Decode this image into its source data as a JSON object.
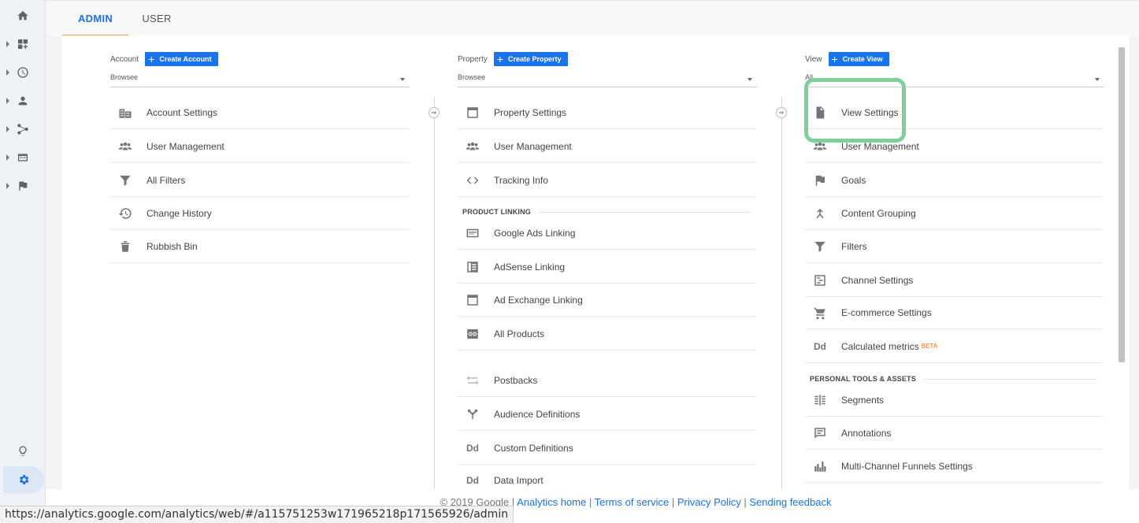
{
  "tabs": {
    "admin": "ADMIN",
    "user": "USER"
  },
  "account": {
    "label": "Account",
    "create": "Create Account",
    "selected": "Browsee",
    "items": [
      {
        "label": "Account Settings",
        "icon": "building-icon"
      },
      {
        "label": "User Management",
        "icon": "people-icon"
      },
      {
        "label": "All Filters",
        "icon": "filter-icon"
      },
      {
        "label": "Change History",
        "icon": "history-icon"
      },
      {
        "label": "Rubbish Bin",
        "icon": "trash-icon"
      }
    ]
  },
  "property": {
    "label": "Property",
    "create": "Create Property",
    "selected": "Browsee",
    "items": [
      {
        "label": "Property Settings",
        "icon": "square-icon"
      },
      {
        "label": "User Management",
        "icon": "people-icon"
      },
      {
        "label": "Tracking Info",
        "icon": "code-icon"
      }
    ],
    "linking_header": "PRODUCT LINKING",
    "linking": [
      {
        "label": "Google Ads Linking",
        "icon": "ads-icon"
      },
      {
        "label": "AdSense Linking",
        "icon": "adsense-icon"
      },
      {
        "label": "Ad Exchange Linking",
        "icon": "square-icon"
      },
      {
        "label": "All Products",
        "icon": "link-icon"
      }
    ],
    "more": [
      {
        "label": "Postbacks",
        "icon": "swap-icon"
      },
      {
        "label": "Audience Definitions",
        "icon": "fork-icon"
      },
      {
        "label": "Custom Definitions",
        "icon": "dd-icon",
        "text_icon": "Dd"
      },
      {
        "label": "Data Import",
        "icon": "dd-icon",
        "text_icon": "Dd"
      }
    ]
  },
  "view": {
    "label": "View",
    "create": "Create View",
    "selected": "All",
    "items": [
      {
        "label": "View Settings",
        "icon": "document-icon"
      },
      {
        "label": "User Management",
        "icon": "people-icon"
      },
      {
        "label": "Goals",
        "icon": "flag-icon"
      },
      {
        "label": "Content Grouping",
        "icon": "grouping-icon"
      },
      {
        "label": "Filters",
        "icon": "filter-icon"
      },
      {
        "label": "Channel Settings",
        "icon": "channel-icon"
      },
      {
        "label": "E-commerce Settings",
        "icon": "cart-icon"
      },
      {
        "label": "Calculated metrics",
        "icon": "dd-icon",
        "text_icon": "Dd",
        "badge": "BETA"
      }
    ],
    "tools_header": "PERSONAL TOOLS & ASSETS",
    "tools": [
      {
        "label": "Segments",
        "icon": "segments-icon"
      },
      {
        "label": "Annotations",
        "icon": "comment-icon"
      },
      {
        "label": "Multi-Channel Funnels Settings",
        "icon": "bars-icon"
      }
    ]
  },
  "footer": {
    "copyright": "© 2019 Google",
    "links": [
      "Analytics home",
      "Terms of service",
      "Privacy Policy",
      "Sending feedback"
    ],
    "separator": " | "
  },
  "status_url": "https://analytics.google.com/analytics/web/#/a115751253w171965218p171565926/admin",
  "colors": {
    "accent": "#1a73e8",
    "tab_underline": "#f29d36",
    "highlight": "#7fcf9b",
    "beta": "#e8710a"
  }
}
